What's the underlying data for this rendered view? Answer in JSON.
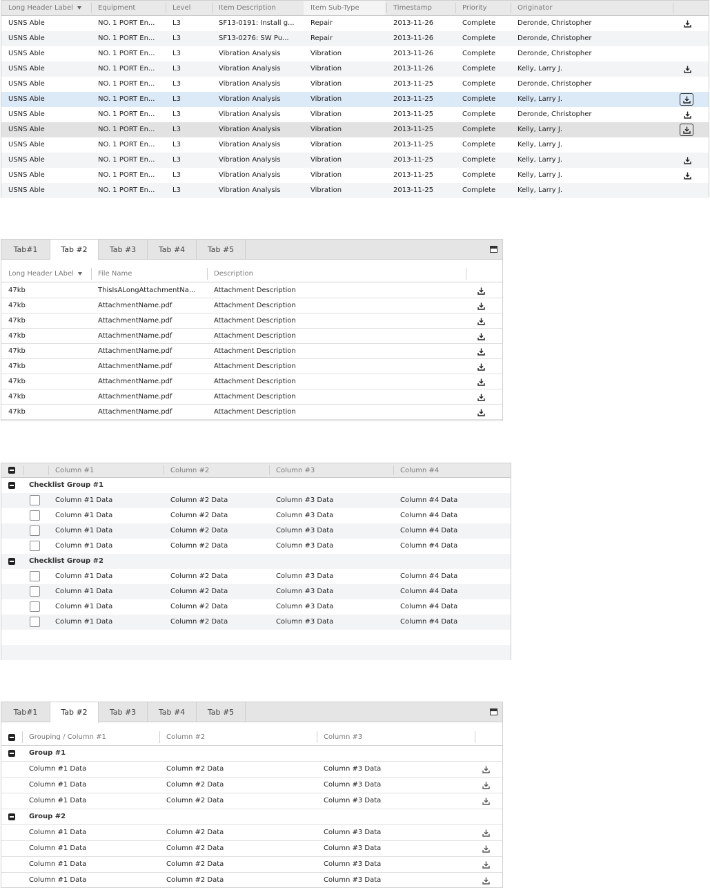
{
  "grid1": {
    "headers": [
      "Long Header Label",
      "Equipment",
      "Level",
      "Item Description",
      "Item Sub-Type",
      "Timestamp",
      "Priority",
      "Originator"
    ],
    "rows": [
      [
        "USNS Able",
        "NO. 1 PORT En...",
        "L3",
        "SF13-0191: Install g...",
        "Repair",
        "2013-11-26",
        "Complete",
        "Deronde, Christopher"
      ],
      [
        "USNS Able",
        "NO. 1 PORT En...",
        "L3",
        "SF13-0276: SW Pu...",
        "Repair",
        "2013-11-26",
        "Complete",
        "Deronde, Christopher"
      ],
      [
        "USNS Able",
        "NO. 1 PORT En...",
        "L3",
        "Vibration Analysis",
        "Vibration",
        "2013-11-26",
        "Complete",
        "Deronde, Christopher"
      ],
      [
        "USNS Able",
        "NO. 1 PORT En...",
        "L3",
        "Vibration Analysis",
        "Vibration",
        "2013-11-26",
        "Complete",
        "Kelly, Larry J."
      ],
      [
        "USNS Able",
        "NO. 1 PORT En...",
        "L3",
        "Vibration Analysis",
        "Vibration",
        "2013-11-25",
        "Complete",
        "Deronde, Christopher"
      ],
      [
        "USNS Able",
        "NO. 1 PORT En...",
        "L3",
        "Vibration Analysis",
        "Vibration",
        "2013-11-25",
        "Complete",
        "Kelly, Larry J."
      ],
      [
        "USNS Able",
        "NO. 1 PORT En...",
        "L3",
        "Vibration Analysis",
        "Vibration",
        "2013-11-25",
        "Complete",
        "Deronde, Christopher"
      ],
      [
        "USNS Able",
        "NO. 1 PORT En...",
        "L3",
        "Vibration Analysis",
        "Vibration",
        "2013-11-25",
        "Complete",
        "Kelly, Larry J."
      ],
      [
        "USNS Able",
        "NO. 1 PORT En...",
        "L3",
        "Vibration Analysis",
        "Vibration",
        "2013-11-25",
        "Complete",
        "Kelly, Larry J."
      ],
      [
        "USNS Able",
        "NO. 1 PORT En...",
        "L3",
        "Vibration Analysis",
        "Vibration",
        "2013-11-25",
        "Complete",
        "Kelly, Larry J."
      ],
      [
        "USNS Able",
        "NO. 1 PORT En...",
        "L3",
        "Vibration Analysis",
        "Vibration",
        "2013-11-25",
        "Complete",
        "Kelly, Larry J."
      ],
      [
        "USNS Able",
        "NO. 1 PORT En...",
        "L3",
        "Vibration Analysis",
        "Vibration",
        "2013-11-25",
        "Complete",
        "Kelly, Larry J."
      ]
    ],
    "download_icon": "download-icon"
  },
  "tabs1": {
    "tabs": [
      "Tab#1",
      "Tab #2",
      "Tab #3",
      "Tab #4",
      "Tab #5"
    ],
    "active_tab": "Tab #2",
    "headers": [
      "Long Header LAbel",
      "File Name",
      "Description"
    ],
    "rows": [
      [
        "47kb",
        "ThisIsALongAttachmentNa...",
        "Attachment Description"
      ],
      [
        "47kb",
        "AttachmentName.pdf",
        "Attachment Description"
      ],
      [
        "47kb",
        "AttachmentName.pdf",
        "Attachment Description"
      ],
      [
        "47kb",
        "AttachmentName.pdf",
        "Attachment Description"
      ],
      [
        "47kb",
        "AttachmentName.pdf",
        "Attachment Description"
      ],
      [
        "47kb",
        "AttachmentName.pdf",
        "Attachment Description"
      ],
      [
        "47kb",
        "AttachmentName.pdf",
        "Attachment Description"
      ],
      [
        "47kb",
        "AttachmentName.pdf",
        "Attachment Description"
      ],
      [
        "47kb",
        "AttachmentName.pdf",
        "Attachment Description"
      ]
    ]
  },
  "checklist": {
    "headers": [
      "Column #1",
      "Column #2",
      "Column #3",
      "Column #4"
    ],
    "groups": [
      {
        "name": "Checklist Group #1",
        "rows": [
          [
            "Column #1 Data",
            "Column #2 Data",
            "Column #3 Data",
            "Column #4 Data"
          ],
          [
            "Column #1 Data",
            "Column #2 Data",
            "Column #3 Data",
            "Column #4 Data"
          ],
          [
            "Column #1 Data",
            "Column #2 Data",
            "Column #3 Data",
            "Column #4 Data"
          ],
          [
            "Column #1 Data",
            "Column #2 Data",
            "Column #3 Data",
            "Column #4 Data"
          ]
        ]
      },
      {
        "name": "Checklist Group #2",
        "rows": [
          [
            "Column #1 Data",
            "Column #2 Data",
            "Column #3 Data",
            "Column #4 Data"
          ],
          [
            "Column #1 Data",
            "Column #2 Data",
            "Column #3 Data",
            "Column #4 Data"
          ],
          [
            "Column #1 Data",
            "Column #2 Data",
            "Column #3 Data",
            "Column #4 Data"
          ],
          [
            "Column #1 Data",
            "Column #2 Data",
            "Column #3 Data",
            "Column #4 Data"
          ]
        ]
      }
    ]
  },
  "tabs2": {
    "tabs": [
      "Tab#1",
      "Tab #2",
      "Tab #3",
      "Tab #4",
      "Tab #5"
    ],
    "active_tab": "Tab #2",
    "headers": [
      "Grouping / Column #1",
      "Column #2",
      "Column #3"
    ],
    "groups": [
      {
        "name": "Group #1",
        "rows": [
          [
            "Column #1 Data",
            "Column #2 Data",
            "Column #3 Data"
          ],
          [
            "Column #1 Data",
            "Column #2 Data",
            "Column #3 Data"
          ],
          [
            "Column #1 Data",
            "Column #2 Data",
            "Column #3 Data"
          ]
        ]
      },
      {
        "name": "Group #2",
        "rows": [
          [
            "Column #1 Data",
            "Column #2 Data",
            "Column #3 Data"
          ],
          [
            "Column #1 Data",
            "Column #2 Data",
            "Column #3 Data"
          ],
          [
            "Column #1 Data",
            "Column #2 Data",
            "Column #3 Data"
          ],
          [
            "Column #1 Data",
            "Column #2 Data",
            "Column #3 Data"
          ]
        ]
      }
    ]
  },
  "colors": {
    "selected_row": "#dce9f7",
    "hover_row": "#e2e2e3",
    "alt_row": "#f3f4f6",
    "header_bg": "#e9e9e9"
  }
}
